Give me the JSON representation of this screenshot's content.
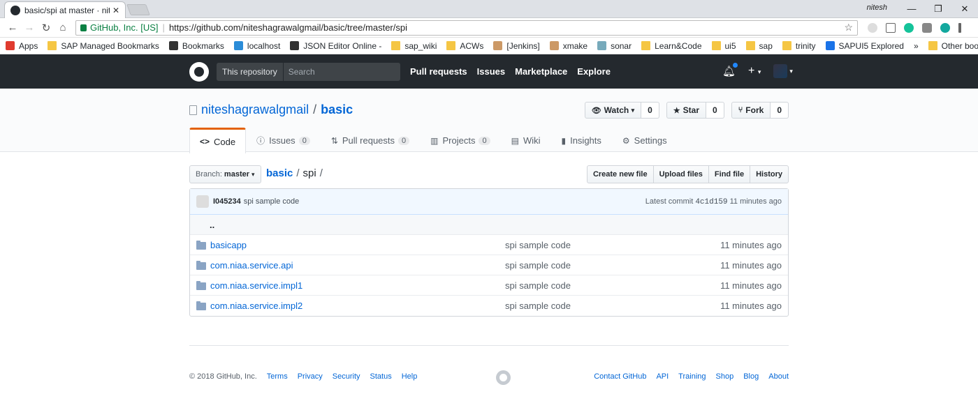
{
  "browser": {
    "tab_title": "basic/spi at master · nites",
    "user_label": "nitesh",
    "security_label": "GitHub, Inc. [US]",
    "url": "https://github.com/niteshagrawalgmail/basic/tree/master/spi",
    "bookmarks": [
      "Apps",
      "SAP Managed Bookmarks",
      "Bookmarks",
      "localhost",
      "JSON Editor Online -",
      "sap_wiki",
      "ACWs",
      "[Jenkins]",
      "xmake",
      "sonar",
      "Learn&Code",
      "ui5",
      "sap",
      "trinity",
      "SAPUI5 Explored"
    ],
    "overflow": "»",
    "other_bookmarks": "Other bookmarks"
  },
  "gh_header": {
    "search_scope": "This repository",
    "search_placeholder": "Search",
    "nav": [
      "Pull requests",
      "Issues",
      "Marketplace",
      "Explore"
    ],
    "plus": "+"
  },
  "repo": {
    "owner": "niteshagrawalgmail",
    "name": "basic",
    "watch_label": "Watch",
    "watch_count": "0",
    "star_label": "Star",
    "star_count": "0",
    "fork_label": "Fork",
    "fork_count": "0",
    "tabs": [
      {
        "label": "Code"
      },
      {
        "label": "Issues",
        "count": "0"
      },
      {
        "label": "Pull requests",
        "count": "0"
      },
      {
        "label": "Projects",
        "count": "0"
      },
      {
        "label": "Wiki"
      },
      {
        "label": "Insights"
      },
      {
        "label": "Settings"
      }
    ]
  },
  "filenav": {
    "branch_label": "Branch:",
    "branch": "master",
    "crumb_root": "basic",
    "crumb_dir": "spi",
    "buttons": [
      "Create new file",
      "Upload files",
      "Find file",
      "History"
    ]
  },
  "commit": {
    "author": "I045234",
    "message": "spi sample code",
    "latest_label": "Latest commit",
    "sha": "4c1d159",
    "age": "11 minutes ago"
  },
  "up_dir": "..",
  "files": [
    {
      "name": "basicapp",
      "msg": "spi sample code",
      "age": "11 minutes ago"
    },
    {
      "name": "com.niaa.service.api",
      "msg": "spi sample code",
      "age": "11 minutes ago"
    },
    {
      "name": "com.niaa.service.impl1",
      "msg": "spi sample code",
      "age": "11 minutes ago"
    },
    {
      "name": "com.niaa.service.impl2",
      "msg": "spi sample code",
      "age": "11 minutes ago"
    }
  ],
  "footer": {
    "copyright": "© 2018 GitHub, Inc.",
    "left_links": [
      "Terms",
      "Privacy",
      "Security",
      "Status",
      "Help"
    ],
    "right_links": [
      "Contact GitHub",
      "API",
      "Training",
      "Shop",
      "Blog",
      "About"
    ]
  }
}
